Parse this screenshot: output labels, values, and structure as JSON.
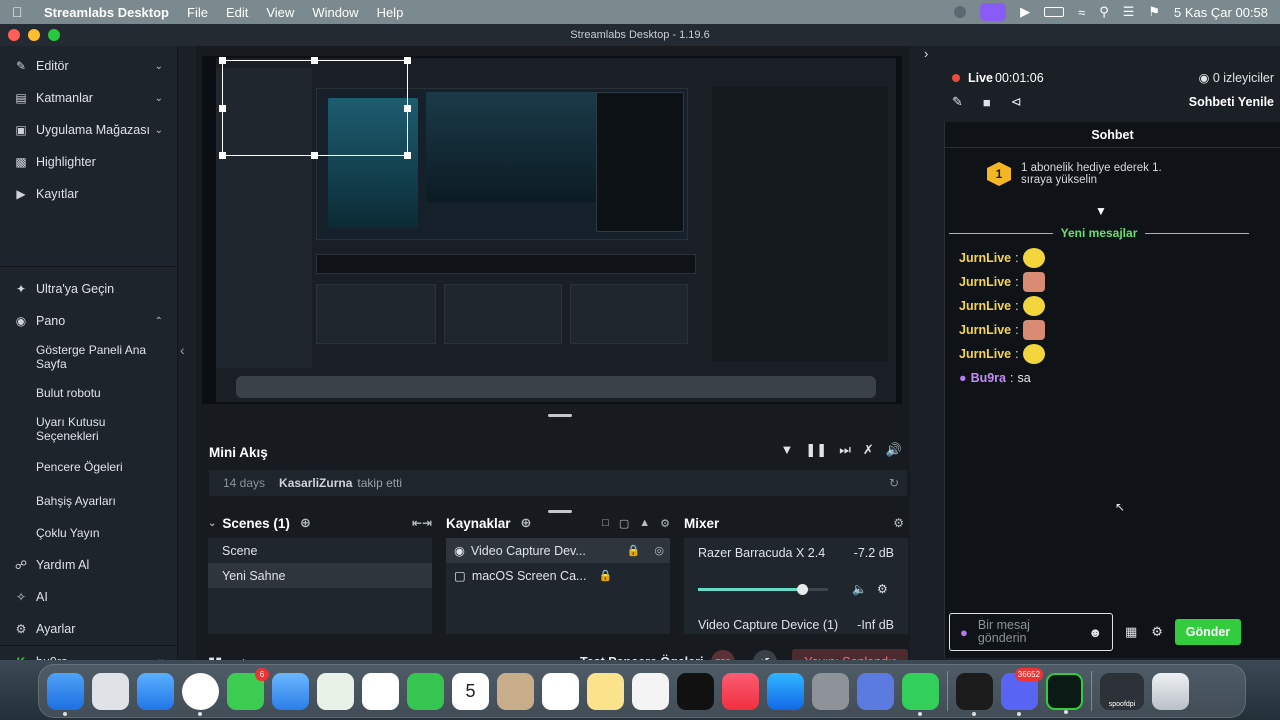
{
  "menubar": {
    "app_name": "Streamlabs Desktop",
    "menus": [
      "File",
      "Edit",
      "View",
      "Window",
      "Help"
    ],
    "clock": "5 Kas Çar  00:58"
  },
  "window": {
    "title": "Streamlabs Desktop - 1.19.6"
  },
  "sidebar": {
    "top_items": [
      {
        "label": "Editör",
        "icon": "pencil-icon",
        "chevron": "chevron-down-icon"
      },
      {
        "label": "Katmanlar",
        "icon": "layers-icon",
        "chevron": "chevron-down-icon"
      },
      {
        "label": "Uygulama Mağazası",
        "icon": "store-icon",
        "chevron": "chevron-down-icon"
      },
      {
        "label": "Highlighter",
        "icon": "highlighter-icon"
      },
      {
        "label": "Kayıtlar",
        "icon": "play-icon"
      }
    ],
    "ultra": "Ultra'ya Geçin",
    "pano": "Pano",
    "pano_items": [
      "Gösterge Paneli Ana Sayfa",
      "Bulut robotu",
      "Uyarı Kutusu Seçenekleri",
      "Pencere Ögeleri",
      "Bahşiş Ayarları",
      "Çoklu Yayın"
    ],
    "bottom_items": [
      "Yardım Al",
      "AI",
      "Ayarlar"
    ],
    "user": "bu9ra"
  },
  "mini_akis": {
    "title": "Mini Akış",
    "feed": [
      {
        "time": "14 days",
        "user": "KasarliZurna",
        "action": "takip etti"
      }
    ]
  },
  "scenes": {
    "title": "Scenes (1)",
    "items": [
      "Scene",
      "Yeni Sahne"
    ],
    "selected": "Yeni Sahne"
  },
  "sources": {
    "title": "Kaynaklar",
    "items": [
      "Video Capture Dev...",
      "macOS Screen Ca..."
    ]
  },
  "mixer": {
    "title": "Mixer",
    "channels": [
      {
        "name": "Razer Barracuda X 2.4",
        "level": "-7.2 dB",
        "volume": 0.8
      },
      {
        "name": "Video Capture Device (1)",
        "level": "-Inf dB"
      }
    ]
  },
  "footer": {
    "test_label": "Test Pencere Ögeleri",
    "rec_label": "REC",
    "end_label": "Yayını Sonlandır"
  },
  "chat": {
    "live_label": "Live",
    "live_time": "00:01:06",
    "viewers": "0 izleyiciler",
    "refresh_label": "Sohbeti Yenile",
    "header": "Sohbet",
    "gift_badge": "1",
    "gift_text": "1 abonelik hediye ederek 1. sıraya yükselin",
    "new_messages": "Yeni mesajlar",
    "messages": [
      {
        "name": "JurnLive",
        "emote": "yellow"
      },
      {
        "name": "JurnLive",
        "emote": "face"
      },
      {
        "name": "JurnLive",
        "emote": "yellow"
      },
      {
        "name": "JurnLive",
        "emote": "face"
      },
      {
        "name": "JurnLive",
        "emote": "yellow"
      },
      {
        "name": "Bu9ra",
        "text": "sa"
      }
    ],
    "input_placeholder": "Bir mesaj gönderin",
    "send_label": "Gönder"
  },
  "dock": {
    "messages_badge": "6",
    "calendar_day": "5",
    "discord_badge": "36652",
    "screenshot_label": "spoofdpi"
  },
  "colors": {
    "accent_green": "#33cc3f",
    "new_msg_green": "#66e06e",
    "end_red": "#ff6f6f",
    "username_yellow": "#f7d54a"
  }
}
